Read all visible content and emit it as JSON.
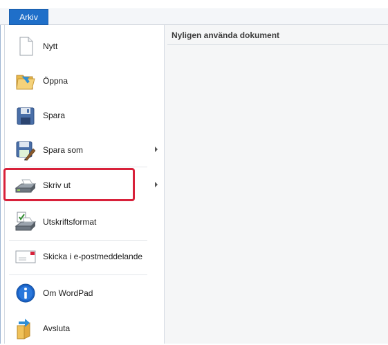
{
  "ribbon": {
    "file_tab_label": "Arkiv"
  },
  "menu": {
    "items": [
      {
        "label": "Nytt",
        "icon": "new-document-icon",
        "has_submenu": false
      },
      {
        "label": "Öppna",
        "icon": "open-folder-icon",
        "has_submenu": false
      },
      {
        "label": "Spara",
        "icon": "save-disk-icon",
        "has_submenu": false
      },
      {
        "label": "Spara som",
        "icon": "save-as-icon",
        "has_submenu": true
      },
      {
        "label": "Skriv ut",
        "icon": "printer-icon",
        "has_submenu": true
      },
      {
        "label": "Utskriftsformat",
        "icon": "page-setup-icon",
        "has_submenu": false
      },
      {
        "label": "Skicka i e-postmeddelande",
        "icon": "email-icon",
        "has_submenu": false
      },
      {
        "label": "Om WordPad",
        "icon": "info-icon",
        "has_submenu": false
      },
      {
        "label": "Avsluta",
        "icon": "exit-icon",
        "has_submenu": false
      }
    ],
    "highlighted_item": "Skriv ut",
    "highlight_color": "#d8213a"
  },
  "recent": {
    "title": "Nyligen använda dokument"
  },
  "colors": {
    "file_tab": "#1f6fc9",
    "info_icon": "#1b63c6",
    "highlight": "#d8213a"
  }
}
